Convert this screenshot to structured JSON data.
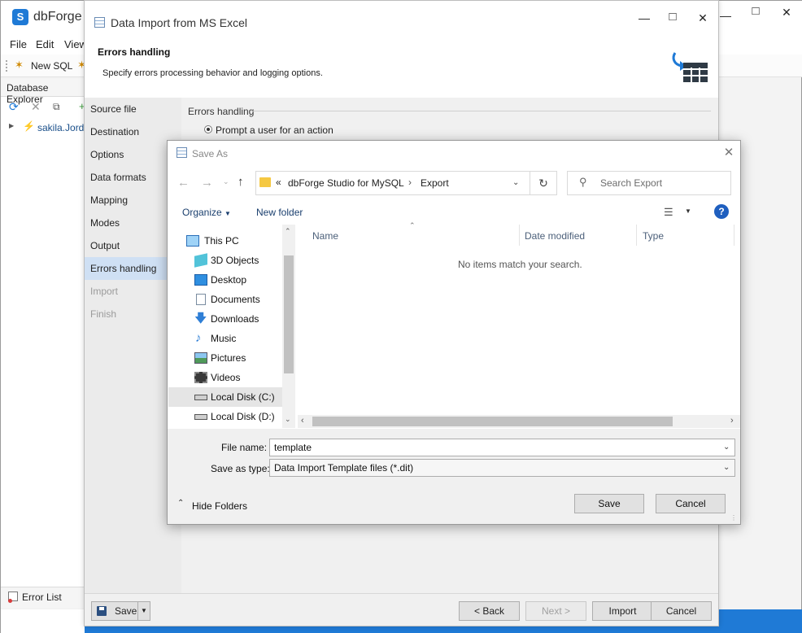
{
  "app": {
    "title": "dbForge S",
    "menu": [
      "File",
      "Edit",
      "View"
    ],
    "toolbar_new_sql": "New SQL",
    "db_explorer_title": "Database Explorer",
    "tree_connection": "sakila.Jorda",
    "error_list": "Error List",
    "colors": {
      "accent": "#1f7ad6",
      "nav_active": "#cfe0f4"
    }
  },
  "wizard": {
    "title": "Data Import from MS Excel",
    "header_title": "Errors handling",
    "header_desc": "Specify errors processing behavior and logging options.",
    "nav": [
      {
        "label": "Source file",
        "state": "normal"
      },
      {
        "label": "Destination",
        "state": "normal"
      },
      {
        "label": "Options",
        "state": "normal"
      },
      {
        "label": "Data formats",
        "state": "normal"
      },
      {
        "label": "Mapping",
        "state": "normal"
      },
      {
        "label": "Modes",
        "state": "normal"
      },
      {
        "label": "Output",
        "state": "normal"
      },
      {
        "label": "Errors handling",
        "state": "active"
      },
      {
        "label": "Import",
        "state": "disabled"
      },
      {
        "label": "Finish",
        "state": "disabled"
      }
    ],
    "section_title": "Errors handling",
    "radio_prompt": "Prompt a user for an action",
    "footer": {
      "save": "Save",
      "back": "< Back",
      "next": "Next >",
      "import": "Import",
      "cancel": "Cancel"
    }
  },
  "save_as": {
    "title": "Save As",
    "breadcrumb": {
      "overflow": "«",
      "parent": "dbForge Studio for MySQL",
      "current": "Export"
    },
    "search_placeholder": "Search Export",
    "organize": "Organize",
    "new_folder": "New folder",
    "tree": [
      {
        "label": "This PC",
        "icon": "computer-icon"
      },
      {
        "label": "3D Objects",
        "icon": "cube-icon"
      },
      {
        "label": "Desktop",
        "icon": "desktop-icon"
      },
      {
        "label": "Documents",
        "icon": "document-icon"
      },
      {
        "label": "Downloads",
        "icon": "download-icon"
      },
      {
        "label": "Music",
        "icon": "music-icon"
      },
      {
        "label": "Pictures",
        "icon": "picture-icon"
      },
      {
        "label": "Videos",
        "icon": "video-icon"
      },
      {
        "label": "Local Disk (C:)",
        "icon": "drive-icon"
      },
      {
        "label": "Local Disk (D:)",
        "icon": "drive-icon"
      }
    ],
    "columns": [
      "Name",
      "Date modified",
      "Type"
    ],
    "empty_message": "No items match your search.",
    "file_name_label": "File name:",
    "file_name": "template",
    "save_type_label": "Save as type:",
    "save_type": "Data Import Template files (*.dit)",
    "hide_folders": "Hide Folders",
    "save": "Save",
    "cancel": "Cancel"
  }
}
